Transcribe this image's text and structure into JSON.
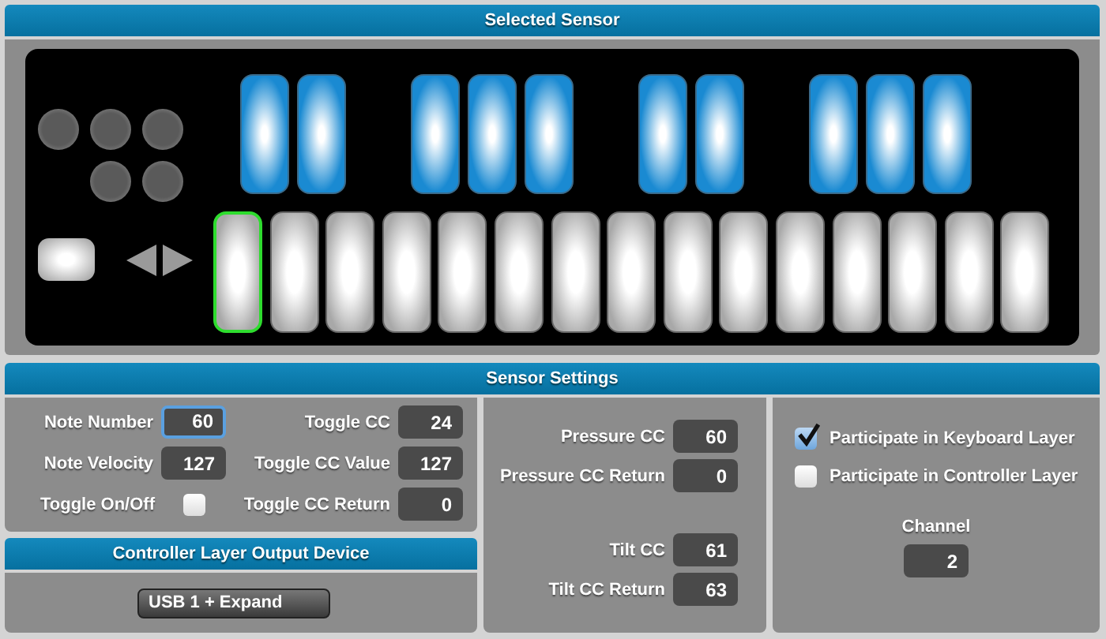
{
  "selected_sensor": {
    "title": "Selected Sensor",
    "round_buttons": [
      {
        "selected": false
      },
      {
        "selected": false
      },
      {
        "selected": false
      },
      {
        "selected": false
      },
      {
        "selected": false
      }
    ],
    "blue_key_groups": [
      {
        "keys": [
          {
            "selected": false
          },
          {
            "selected": false
          }
        ]
      },
      {
        "keys": [
          {
            "selected": false
          },
          {
            "selected": false
          },
          {
            "selected": false
          }
        ]
      },
      {
        "keys": [
          {
            "selected": false
          },
          {
            "selected": false
          }
        ]
      },
      {
        "keys": [
          {
            "selected": false
          },
          {
            "selected": false
          },
          {
            "selected": false
          }
        ]
      }
    ],
    "white_keys": [
      {
        "selected": true
      },
      {
        "selected": false
      },
      {
        "selected": false
      },
      {
        "selected": false
      },
      {
        "selected": false
      },
      {
        "selected": false
      },
      {
        "selected": false
      },
      {
        "selected": false
      },
      {
        "selected": false
      },
      {
        "selected": false
      },
      {
        "selected": false
      },
      {
        "selected": false
      },
      {
        "selected": false
      },
      {
        "selected": false
      },
      {
        "selected": false
      }
    ]
  },
  "sensor_settings": {
    "title": "Sensor Settings",
    "note_fields": [
      {
        "label": "Note Number",
        "value": "60",
        "focused": true
      },
      {
        "label": "Toggle CC",
        "value": "24",
        "focused": false
      },
      {
        "label": "Note Velocity",
        "value": "127",
        "focused": false
      },
      {
        "label": "Toggle CC Value",
        "value": "127",
        "focused": false
      },
      {
        "label": "Toggle On/Off",
        "kind": "checkbox",
        "checked": false
      },
      {
        "label": "Toggle CC Return",
        "value": "0",
        "focused": false
      }
    ],
    "cc_fields": [
      {
        "label": "Pressure CC",
        "value": "60"
      },
      {
        "label": "Pressure CC Return",
        "value": "0"
      },
      {
        "label": "Tilt CC",
        "value": "61"
      },
      {
        "label": "Tilt CC Return",
        "value": "63"
      }
    ],
    "layers": [
      {
        "label": "Participate in Keyboard Layer",
        "checked": true
      },
      {
        "label": "Participate in Controller Layer",
        "checked": false
      }
    ],
    "channel": {
      "label": "Channel",
      "value": "2"
    }
  },
  "output_device": {
    "title": "Controller Layer Output Device",
    "value": "USB 1 + Expand"
  }
}
